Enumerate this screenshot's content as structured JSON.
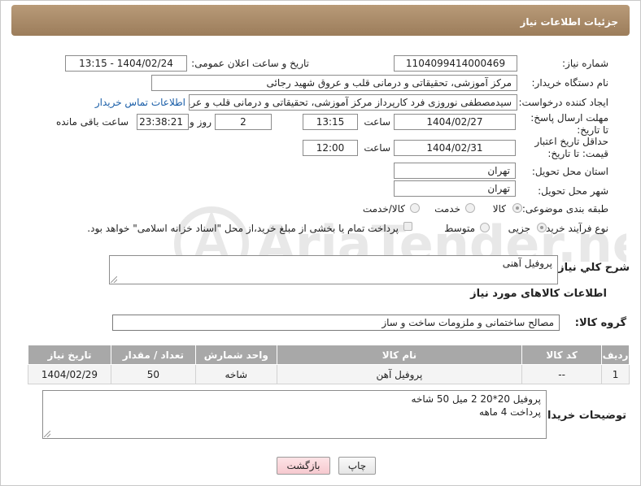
{
  "header": {
    "title": "جزئیات اطلاعات نیاز"
  },
  "labels": {
    "need_number": "شماره نیاز:",
    "announce_datetime": "تاریخ و ساعت اعلان عمومی:",
    "buyer_org": "نام دستگاه خریدار:",
    "requester": "ایجاد کننده درخواست:",
    "reply_deadline": "مهلت ارسال پاسخ: تا تاریخ:",
    "time_word": "ساعت",
    "day_and": "روز و",
    "remaining": "ساعت باقی مانده",
    "price_validity": "حداقل تاریخ اعتبار قیمت: تا تاریخ:",
    "delivery_province": "استان محل تحویل:",
    "delivery_city": "شهر محل تحویل:",
    "category": "طبقه بندی موضوعی:",
    "process_type": "نوع فرآیند خرید :",
    "general_desc": "شرح کلي نياز:",
    "goods_info": "اطلاعات کالاهای مورد نیاز",
    "goods_group": "گروه کالا:",
    "buyer_notes": "توضیحات خریدار:"
  },
  "fields": {
    "need_number": "1104099414000469",
    "announce_datetime": "1404/02/24 - 13:15",
    "buyer_org": "مرکز آموزشی، تحقیقاتی و درمانی قلب و عروق شهید رجائی",
    "requester": "سیدمصطفی نوروزی فرد کارپرداز مرکز آموزشی، تحقیقاتی و درمانی قلب و عروق",
    "contact_link": "اطلاعات تماس خریدار",
    "reply_date": "1404/02/27",
    "reply_time": "13:15",
    "days": "2",
    "remaining_time": "23:38:21",
    "price_date": "1404/02/31",
    "price_time": "12:00",
    "province": "تهران",
    "city": "تهران",
    "general_desc": "پروفیل آهنی",
    "goods_group": "مصالح ساختمانی و ملزومات ساخت و ساز"
  },
  "category_options": [
    {
      "label": "کالا",
      "checked": true
    },
    {
      "label": "خدمت",
      "checked": false
    },
    {
      "label": "کالا/خدمت",
      "checked": false
    }
  ],
  "process_options": [
    {
      "label": "جزیی",
      "checked": true
    },
    {
      "label": "متوسط",
      "checked": false
    }
  ],
  "payment_note": "پرداخت تمام یا بخشی از مبلغ خرید،از محل \"اسناد خزانه اسلامی\" خواهد بود.",
  "table": {
    "headers": [
      "ردیف",
      "کد کالا",
      "نام کالا",
      "واحد شمارش",
      "تعداد / مقدار",
      "تاریخ نیاز"
    ],
    "rows": [
      [
        "1",
        "--",
        "پروفیل آهن",
        "شاخه",
        "50",
        "1404/02/29"
      ]
    ]
  },
  "buyer_notes": [
    "پروفیل 20*20  2 میل  50 شاخه",
    "پرداخت 4 ماهه"
  ],
  "buttons": {
    "print": "چاپ",
    "back": "بازگشت"
  },
  "watermark": {
    "text": "AriaTender.neT"
  },
  "colors": {
    "header": "#a88a68",
    "table_header": "#a8a8a8",
    "link": "#1a5ea8",
    "back_button": "#f6c9cf"
  }
}
